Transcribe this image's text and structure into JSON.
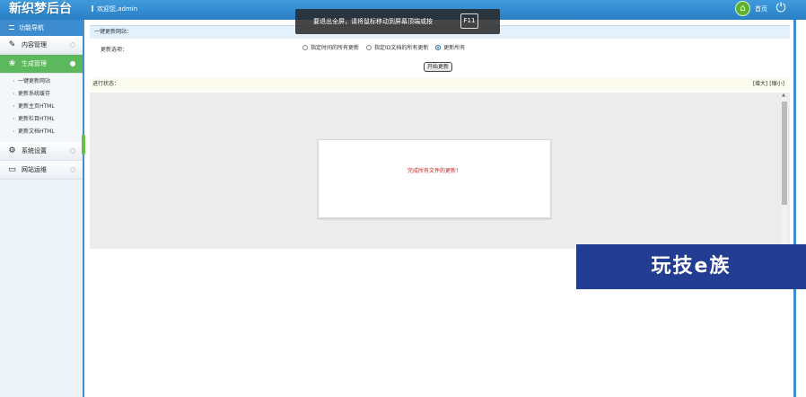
{
  "header": {
    "logo": "新织梦后台",
    "welcome": "欢迎您,admin",
    "home_label": "首页",
    "home_icon": "home-icon",
    "power_icon": "power-icon"
  },
  "overlay": {
    "message": "要退出全屏，请将鼠标移动到屏幕顶端或按",
    "key": "F11"
  },
  "sidebar": {
    "title": "功能导航",
    "groups": [
      {
        "label": "内容管理",
        "icon": "pencil-icon",
        "active": false
      },
      {
        "label": "生成管理",
        "icon": "leaf-icon",
        "active": true
      },
      {
        "label": "系统设置",
        "icon": "gear-icon",
        "active": false
      },
      {
        "label": "网站运维",
        "icon": "monitor-icon",
        "active": false
      }
    ],
    "sub_items": [
      "一键更新网站",
      "更新系统缓存",
      "更新主页HTML",
      "更新栏目HTML",
      "更新文档HTML"
    ]
  },
  "main": {
    "section_title": "一键更新网站：",
    "form_label": "更新选项：",
    "radio_options": [
      {
        "label": "指定时间的所有更新",
        "checked": false
      },
      {
        "label": "指定ID文档的所有更新",
        "checked": false
      },
      {
        "label": "更新所有",
        "checked": true
      }
    ],
    "start_button": "开始更新",
    "status_label": "进行状态：",
    "status_actions": "[增大] [缩小]",
    "result_message": "完成所有文件的更新！"
  },
  "watermark": {
    "text": "玩技e族"
  }
}
